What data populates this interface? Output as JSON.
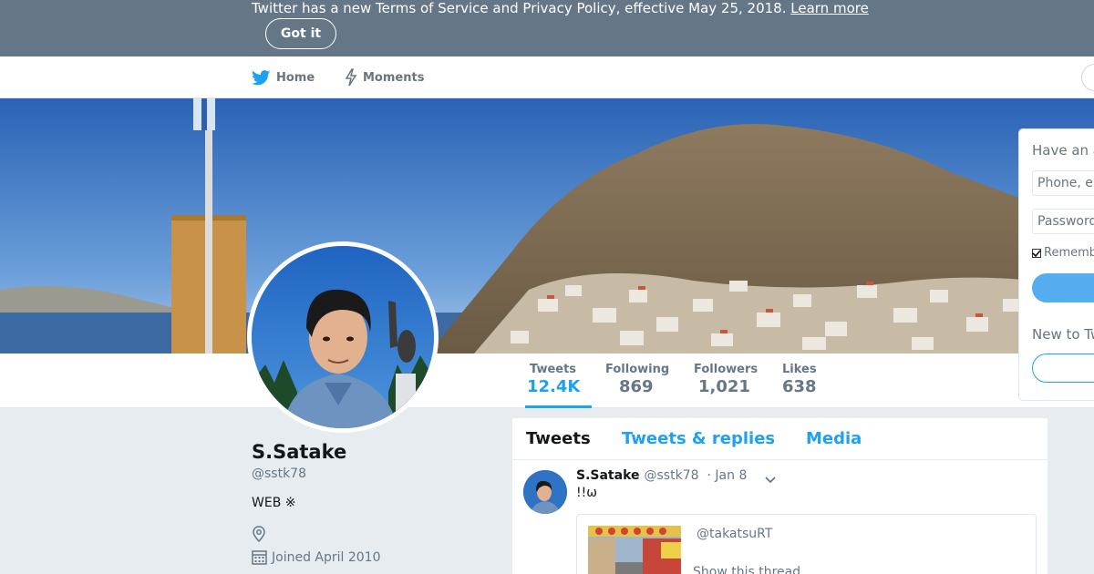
{
  "banner": {
    "text": "Twitter has a new Terms of Service and Privacy Policy, effective May 25, 2018.",
    "link_label": "Learn more",
    "button_label": "Got it"
  },
  "nav": {
    "home_label": "Home",
    "moments_label": "Moments"
  },
  "stats": {
    "tweets": {
      "label": "Tweets",
      "value": "12.4K"
    },
    "following": {
      "label": "Following",
      "value": "869"
    },
    "followers": {
      "label": "Followers",
      "value": "1,021"
    },
    "likes": {
      "label": "Likes",
      "value": "638"
    }
  },
  "profile": {
    "name": "S.Satake",
    "handle": "@sstk78",
    "bio": "WEB ※",
    "joined": "Joined April 2010"
  },
  "timeline": {
    "tabs": [
      "Tweets",
      "Tweets & replies",
      "Media"
    ],
    "tweet": {
      "name": "S.Satake",
      "handle": "@sstk78",
      "date": "· Jan 8",
      "text": "!!ω",
      "quote_handle": "@takatsuRT",
      "quote_show": "Show this thread"
    }
  },
  "login": {
    "title": "Have an account?",
    "phone_placeholder": "Phone, email or username",
    "password_placeholder": "Password",
    "remember_label": "Remember me",
    "new_label": "New to Twitter?"
  },
  "colors": {
    "accent": "#1da1f2",
    "banner_bg": "#657786"
  }
}
